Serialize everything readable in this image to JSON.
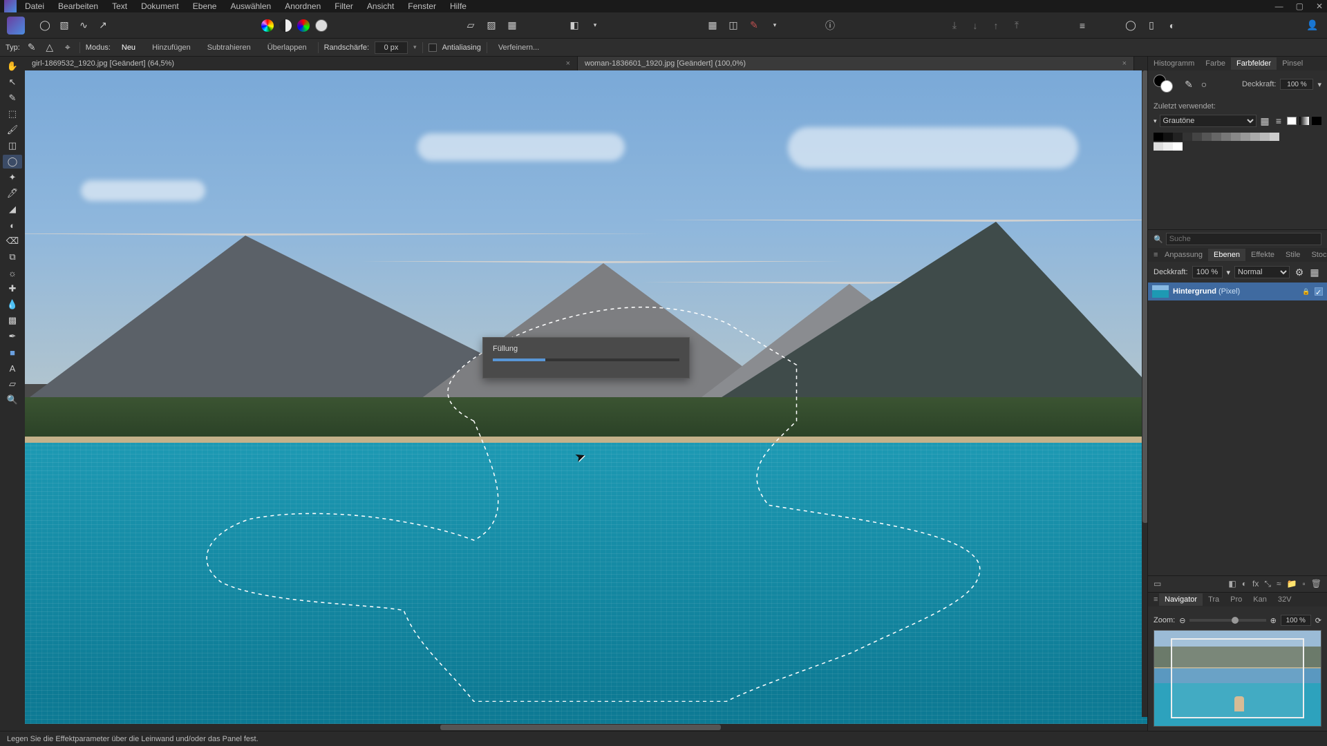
{
  "menu": [
    "Datei",
    "Bearbeiten",
    "Text",
    "Dokument",
    "Ebene",
    "Auswählen",
    "Anordnen",
    "Filter",
    "Ansicht",
    "Fenster",
    "Hilfe"
  ],
  "optbar": {
    "typ_label": "Typ:",
    "modus_label": "Modus:",
    "modes": [
      "Neu",
      "Hinzufügen",
      "Subtrahieren",
      "Überlappen"
    ],
    "feather_label": "Randschärfe:",
    "feather_value": "0 px",
    "antialias_label": "Antialiasing",
    "refine_label": "Verfeinern..."
  },
  "tabs": [
    {
      "label": "girl-1869532_1920.jpg [Geändert] (64,5%)"
    },
    {
      "label": "woman-1836601_1920.jpg [Geändert] (100,0%)"
    }
  ],
  "dialog": {
    "title": "Füllung"
  },
  "right": {
    "top_tabs": [
      "Histogramm",
      "Farbe",
      "Farbfelder",
      "Pinsel"
    ],
    "opacity_label": "Deckkraft:",
    "opacity_value": "100 %",
    "recent_label": "Zuletzt verwendet:",
    "swatch_set": "Grautöne",
    "search_placeholder": "Suche",
    "mid_tabs": [
      "Anpassung",
      "Ebenen",
      "Effekte",
      "Stile",
      "Stock"
    ],
    "layer_opacity_label": "Deckkraft:",
    "layer_opacity_value": "100 %",
    "blend_mode": "Normal",
    "layer_name": "Hintergrund",
    "layer_type": "(Pixel)",
    "nav_tabs": [
      "Navigator",
      "Tra",
      "Pro",
      "Kan",
      "32V"
    ],
    "zoom_label": "Zoom:",
    "zoom_value": "100 %"
  },
  "status": "Legen Sie die Effektparameter über die Leinwand und/oder das Panel fest."
}
